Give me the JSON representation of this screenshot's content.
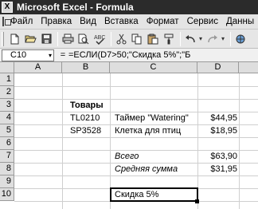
{
  "window": {
    "title": "Microsoft Excel - Formula",
    "app_icon_letter": "X"
  },
  "menu": {
    "items": [
      "Файл",
      "Правка",
      "Вид",
      "Вставка",
      "Формат",
      "Сервис",
      "Данны"
    ]
  },
  "toolbar": {
    "icons": [
      "new-document-icon",
      "open-folder-icon",
      "save-icon",
      "print-icon",
      "print-preview-icon",
      "spelling-icon",
      "cut-icon",
      "copy-icon",
      "paste-icon",
      "format-painter-icon",
      "undo-icon",
      "redo-icon",
      "hyperlink-icon"
    ]
  },
  "formula_bar": {
    "name_box": "C10",
    "fx": "=",
    "formula": "=ЕСЛИ(D7>50;\"Скидка 5%\";\"Б"
  },
  "grid": {
    "columns": [
      "A",
      "B",
      "C",
      "D"
    ],
    "rows": [
      "1",
      "2",
      "3",
      "4",
      "5",
      "6",
      "7",
      "8",
      "9",
      "10"
    ],
    "cells": {
      "B3": "Товары",
      "B4": "TL0210",
      "C4": "Таймер \"Watering\"",
      "D4": "$44,95",
      "B5": "SP3528",
      "C5": "Клетка для птиц",
      "D5": "$18,95",
      "C7": "Всего",
      "D7": "$63,90",
      "C8": "Средняя сумма",
      "D8": "$31,95",
      "C10": "Скидка 5%"
    }
  }
}
